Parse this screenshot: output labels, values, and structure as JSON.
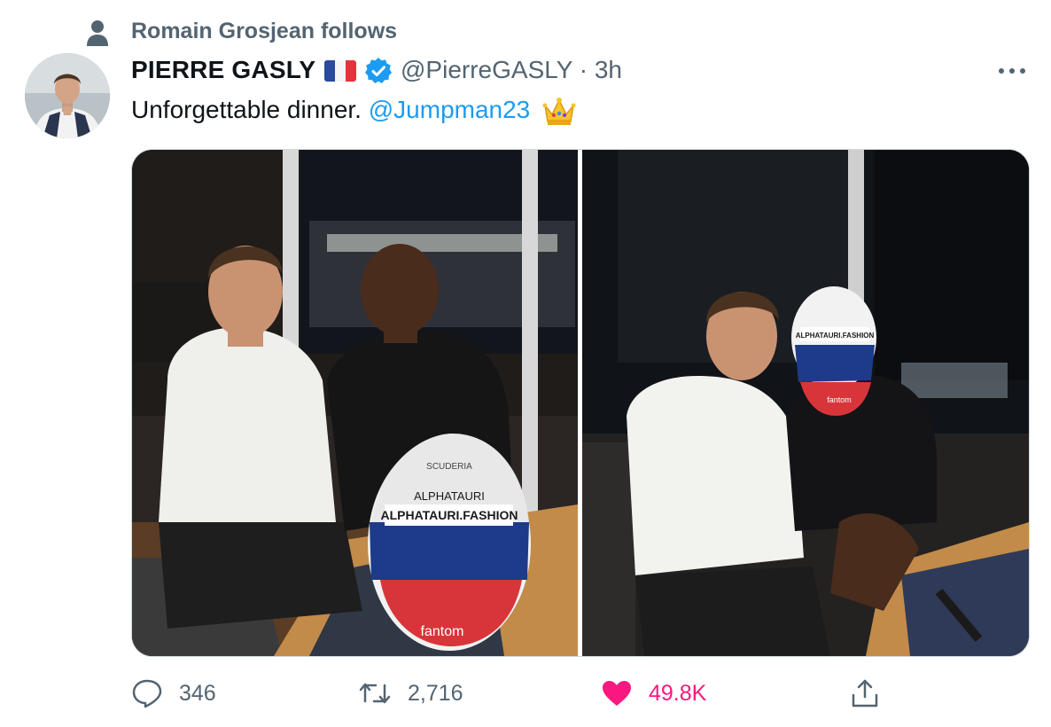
{
  "social_context": {
    "text": "Romain Grosjean follows",
    "icon": "person-icon"
  },
  "author": {
    "name": "PIERRE GASLY",
    "flag": "french-flag",
    "verified": true,
    "handle": "@PierreGASLY",
    "time": "3h"
  },
  "tweet": {
    "text_before": "Unforgettable dinner.",
    "mention": "@Jumpman23",
    "emoji": "crown-emoji"
  },
  "media": {
    "photos": [
      {
        "name": "photo-left",
        "helmet_lines": [
          "SCUDERIA",
          "ALPHATAURI",
          "ALPHATAURI.FASHION",
          "fantom"
        ]
      },
      {
        "name": "photo-right",
        "helmet_lines": [
          "ALPHATAURI.FASHION",
          "fantom"
        ]
      }
    ]
  },
  "actions": {
    "replies": "346",
    "retweets": "2,716",
    "likes": "49.8K"
  },
  "colors": {
    "accent": "#1d9bf0",
    "like": "#f91880",
    "secondary_text": "#536471",
    "primary_text": "#0f1419"
  }
}
